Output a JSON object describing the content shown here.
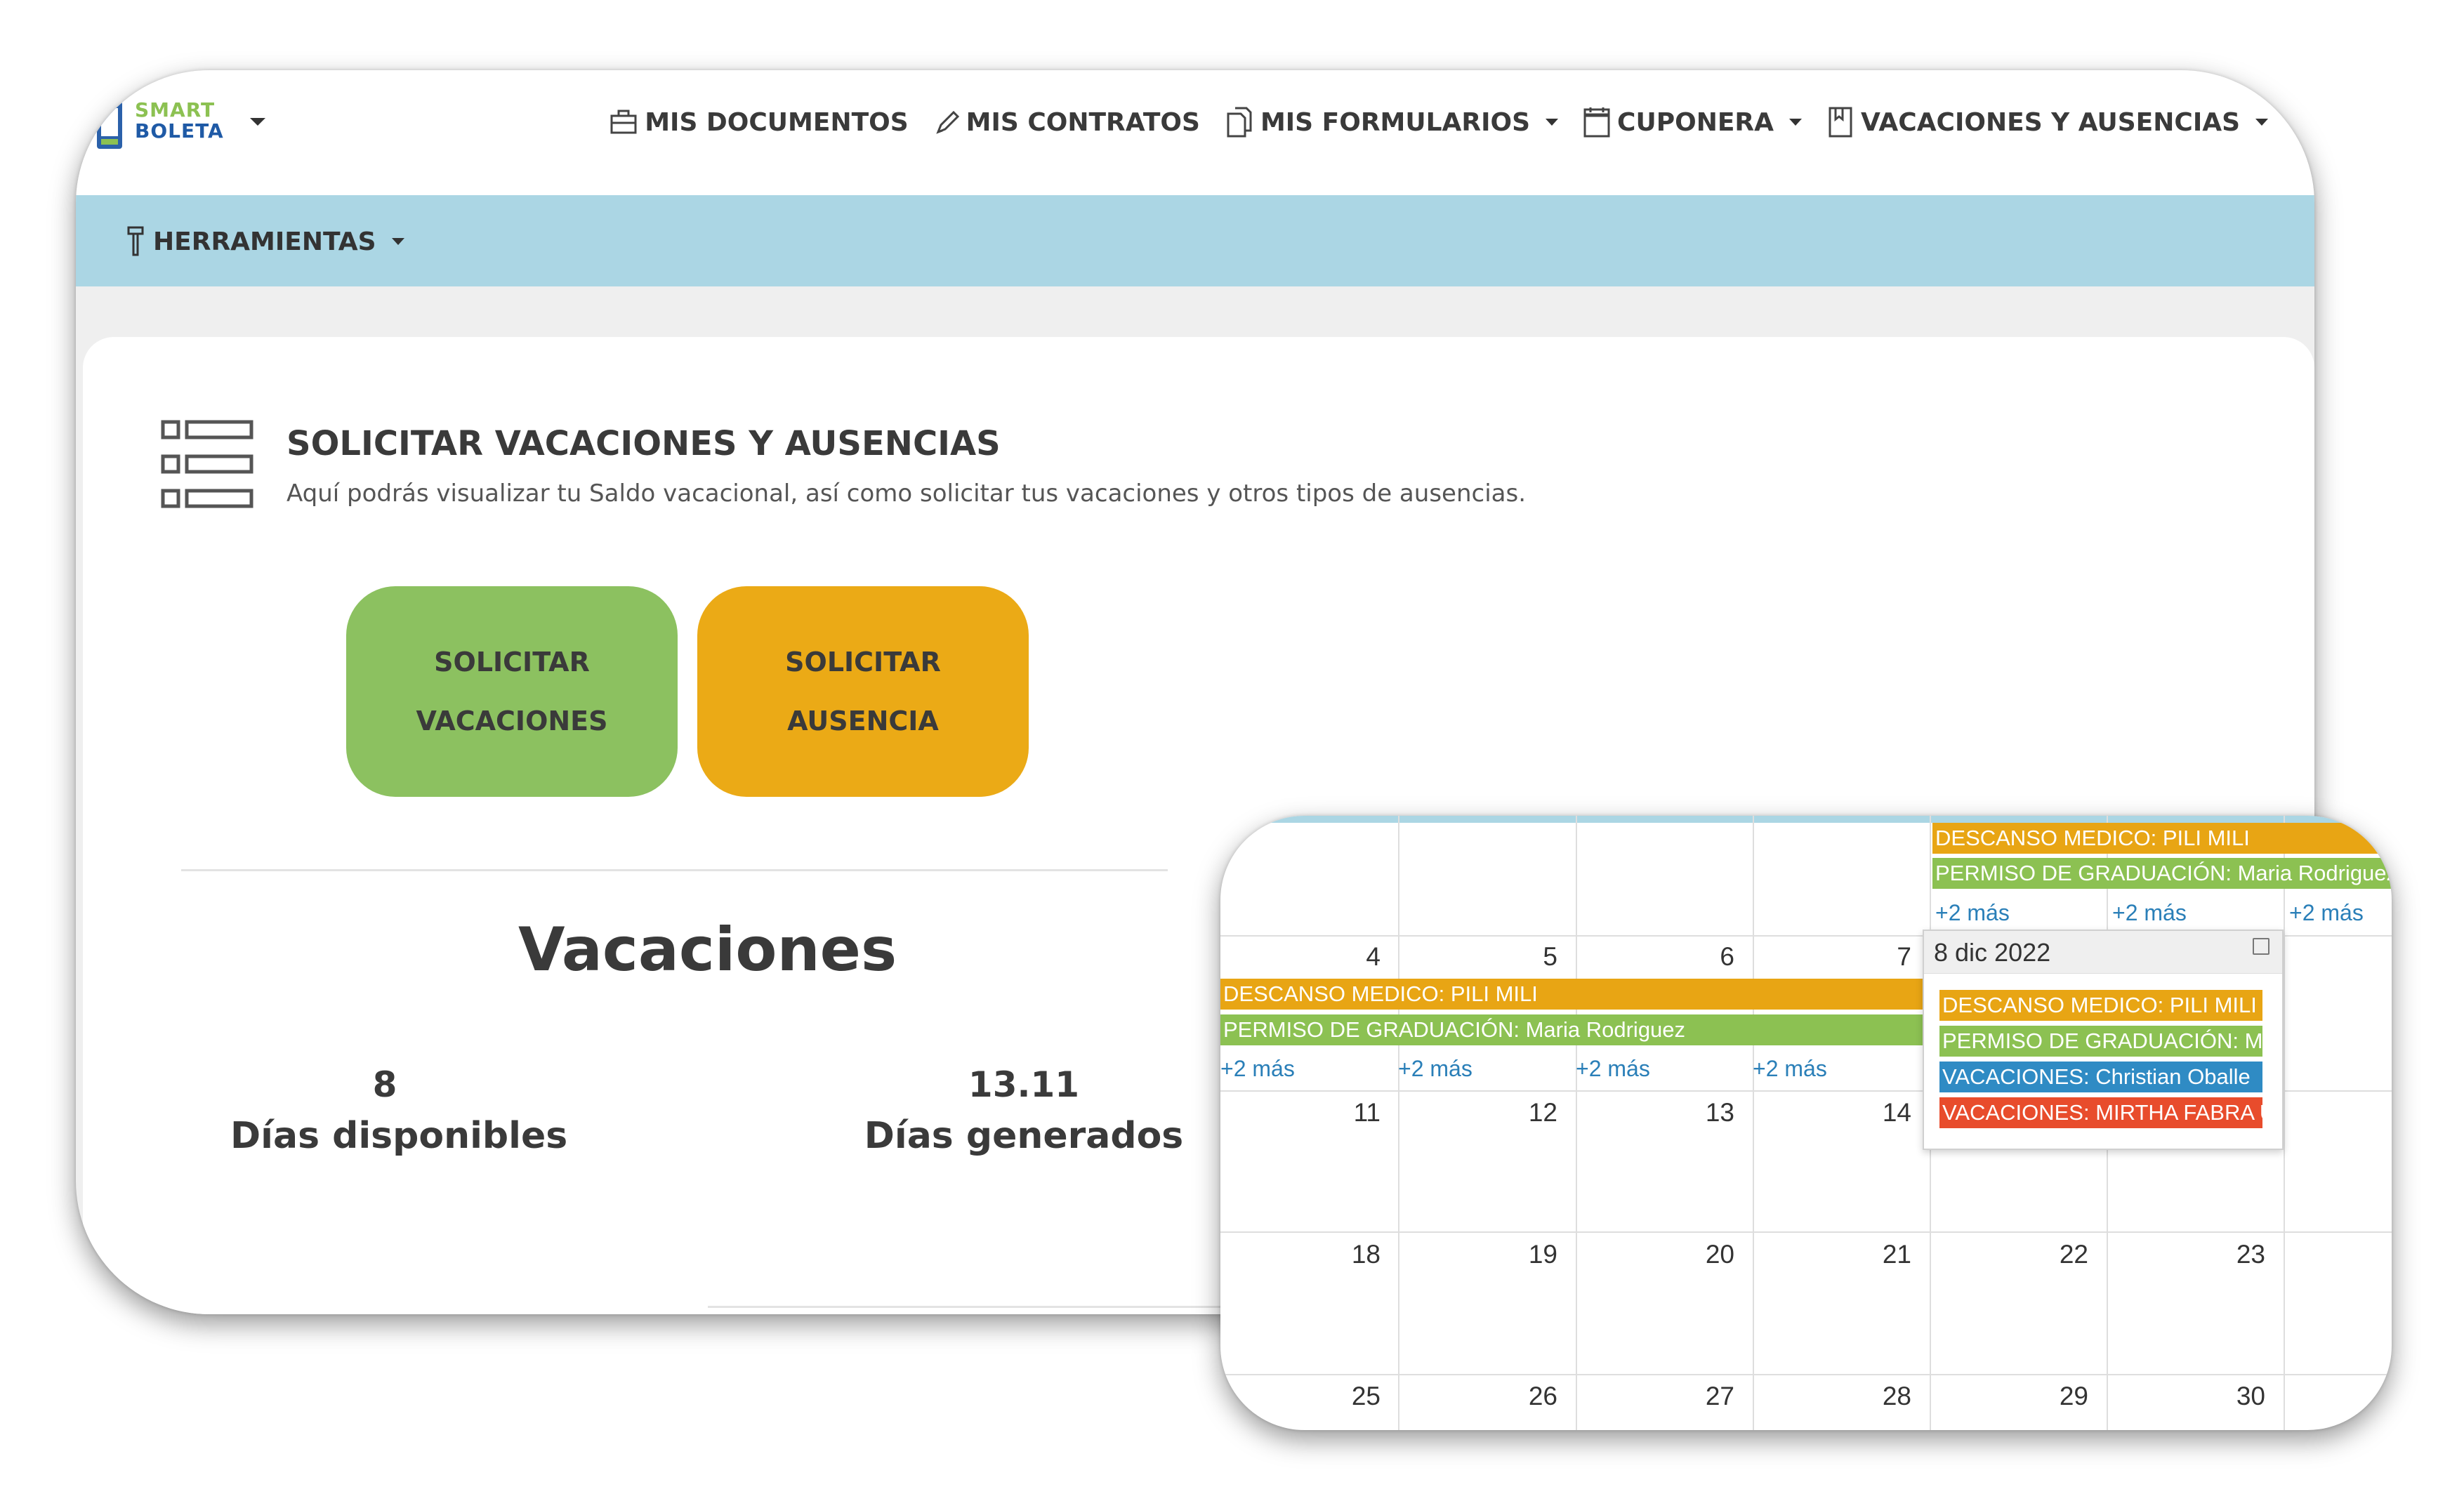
{
  "logo": {
    "line1": "SMART",
    "line2": "BOLETA"
  },
  "nav": {
    "documentos": "MIS DOCUMENTOS",
    "contratos": "MIS CONTRATOS",
    "formularios": "MIS FORMULARIOS",
    "cuponera": "CUPONERA",
    "vacaciones": "VACACIONES Y AUSENCIAS"
  },
  "toolbar": {
    "herramientas": "HERRAMIENTAS"
  },
  "page": {
    "title": "SOLICITAR VACACIONES Y AUSENCIAS",
    "description": "Aquí podrás visualizar tu Saldo vacacional, así como solicitar tus vacaciones y otros tipos de ausencias."
  },
  "buttons": {
    "vacaciones": {
      "line1": "SOLICITAR",
      "line2": "VACACIONES"
    },
    "ausencia": {
      "line1": "SOLICITAR",
      "line2": "AUSENCIA"
    }
  },
  "vacaciones": {
    "title": "Vacaciones",
    "stats": [
      {
        "value": "8",
        "label": "Días disponibles"
      },
      {
        "value": "13.11",
        "label": "Días generados"
      }
    ]
  },
  "calendar": {
    "top_events": {
      "descanso": "DESCANSO MEDICO: PILI MILI",
      "permiso": "PERMISO DE GRADUACIÓN: Maria Rodriguez",
      "more": [
        "+2 más",
        "+2 más",
        "+2 más"
      ]
    },
    "week2": {
      "days": [
        "4",
        "5",
        "6",
        "7"
      ],
      "descanso": "DESCANSO MEDICO: PILI MILI",
      "permiso": "PERMISO DE GRADUACIÓN: Maria Rodriguez",
      "more": [
        "+2 más",
        "+2 más",
        "+2 más",
        "+2 más"
      ]
    },
    "week3": [
      "11",
      "12",
      "13",
      "14"
    ],
    "week4": [
      "18",
      "19",
      "20",
      "21",
      "22",
      "23"
    ],
    "week5": [
      "25",
      "26",
      "27",
      "28",
      "29",
      "30"
    ],
    "popover": {
      "date": "8 dic 2022",
      "events": [
        {
          "text": "DESCANSO MEDICO: PILI MILI",
          "color": "#e8a514"
        },
        {
          "text": "PERMISO DE GRADUACIÓN: Maria Rodriguez",
          "color": "#8cc152"
        },
        {
          "text": "VACACIONES: Christian Oballe",
          "color": "#2f8bc4"
        },
        {
          "text": "VACACIONES: MIRTHA FABRA U",
          "color": "#e84c2c"
        }
      ]
    }
  },
  "colors": {
    "toolbar_bg": "#abd6e4",
    "btn_vacaciones": "#8cc160",
    "btn_ausencia": "#ebaa16",
    "text_dark": "#3a3a3a",
    "link": "#2a7fb8"
  }
}
